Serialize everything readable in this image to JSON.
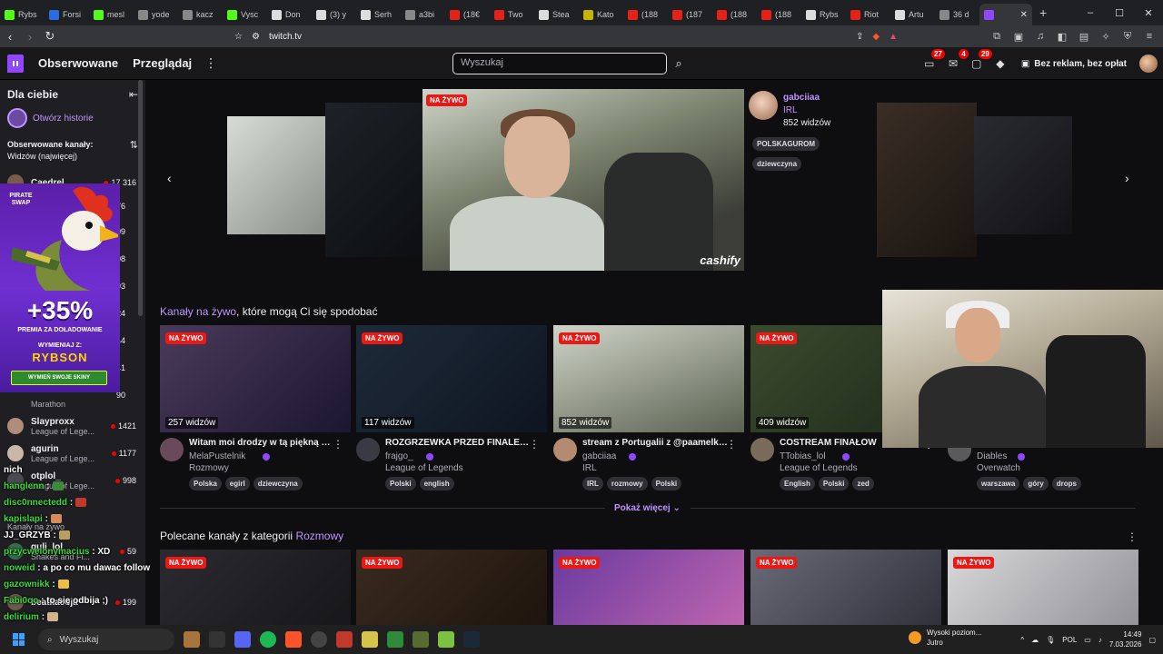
{
  "browser": {
    "tabs": [
      {
        "label": "Rybs",
        "color": "#53fc18"
      },
      {
        "label": "Forsi",
        "color": "#2b6de0"
      },
      {
        "label": "mesl",
        "color": "#53fc18"
      },
      {
        "label": "yode",
        "color": "#888888"
      },
      {
        "label": "kacz",
        "color": "#888888"
      },
      {
        "label": "Vysc",
        "color": "#53fc18"
      },
      {
        "label": "Don",
        "color": "#dddddd"
      },
      {
        "label": "(3) y",
        "color": "#dddddd"
      },
      {
        "label": "Serh",
        "color": "#dddddd"
      },
      {
        "label": "a3bi",
        "color": "#888888"
      },
      {
        "label": "(18€",
        "color": "#e62117"
      },
      {
        "label": "Two",
        "color": "#e62117"
      },
      {
        "label": "Stea",
        "color": "#dddddd"
      },
      {
        "label": "Kato",
        "color": "#c8b400"
      },
      {
        "label": "(188",
        "color": "#e62117"
      },
      {
        "label": "(187",
        "color": "#e62117"
      },
      {
        "label": "(188",
        "color": "#e62117"
      },
      {
        "label": "(188",
        "color": "#e62117"
      },
      {
        "label": "Rybs",
        "color": "#dddddd"
      },
      {
        "label": "Riot",
        "color": "#e62117"
      },
      {
        "label": "Artu",
        "color": "#dddddd"
      },
      {
        "label": "36 d",
        "color": "#888888"
      },
      {
        "label": "",
        "color": "#9147ff",
        "active": true
      }
    ],
    "url": "twitch.tv",
    "window_controls": [
      "–",
      "☐",
      "✕"
    ]
  },
  "topnav": {
    "following": "Obserwowane",
    "browse": "Przeglądaj",
    "search_placeholder": "Wyszukaj",
    "badges": {
      "inbox": "27",
      "whispers": "4",
      "notifications": "29"
    },
    "prime_label": "Bez reklam, bez opłat"
  },
  "sidebar": {
    "title": "Dla ciebie",
    "stories": "Otwórz historie",
    "followed_title": "Obserwowane kanały:",
    "followed_sort": "Widzów (najwięcej)",
    "channels": [
      {
        "name": "Caedrel",
        "game": "",
        "viewers": "17 316"
      },
      {
        "name": "Slayproxx",
        "game": "League of Lege...",
        "viewers": "1421"
      },
      {
        "name": "agurin",
        "game": "League of Lege...",
        "viewers": "1177"
      },
      {
        "name": "otplol_",
        "game": "League of Lege...",
        "viewers": "998"
      },
      {
        "name": "quli_lol",
        "game": "Shakes and Fi...",
        "viewers": "59"
      },
      {
        "name": "beatkacoja",
        "game": "",
        "viewers": "199"
      }
    ],
    "partial_numbers": [
      "76",
      "09",
      "08",
      "93",
      "24",
      "44",
      "41",
      "90"
    ],
    "partial_game": "Marathon",
    "partial_section": "Kanały na żywo"
  },
  "ad": {
    "brand": "PIRATE SWAP",
    "percent": "+35%",
    "subtitle": "PREMIA ZA DOŁADOWANIE",
    "with_label": "WYMIENIAJ Z:",
    "code": "RYBSON",
    "button": "WYMIEŃ SWOJE SKINY"
  },
  "chat_overlay": [
    {
      "user": "nich",
      "msg": "",
      "color": "#ffffff"
    },
    {
      "user": "hanglenn",
      "msg": ":",
      "color": "#3cd93c"
    },
    {
      "user": "disc0nnectedd",
      "msg": ":",
      "color": "#3cd93c"
    },
    {
      "user": "kapislapi",
      "msg": ":",
      "color": "#3cd93c"
    },
    {
      "user": "JJ_GRZYB",
      "msg": ":",
      "color": "#ffffff"
    },
    {
      "user": "przycwelonymacius",
      "msg": ": XD",
      "color": "#3cd93c"
    },
    {
      "user": "noweid",
      "msg": ": a po co mu dawac follow",
      "color": "#3cd93c"
    },
    {
      "user": "gazownikk",
      "msg": ":",
      "color": "#3cd93c"
    },
    {
      "user": "Fabi0oo",
      "msg": ": to się odbija ;)",
      "color": "#3cd93c"
    },
    {
      "user": "delirium",
      "msg": ":",
      "color": "#3cd93c"
    }
  ],
  "hero": {
    "live": "NA ŻYWO",
    "brand_overlay": "cashify",
    "channel": "gabciiaa",
    "category": "IRL",
    "viewers": "852 widzów",
    "tags": [
      "POLSKAGUROM",
      "dziewczyna"
    ]
  },
  "section1": {
    "prefix_highlight": "Kanały na żywo",
    "suffix": ", które mogą Ci się spodobać",
    "cards": [
      {
        "viewers": "257 widzów",
        "title": "Witam moi drodzy w tą piękną sob...",
        "channel": "MelaPustelnik",
        "category": "Rozmowy",
        "tags": [
          "Polska",
          "egirl",
          "dziewczyna"
        ],
        "bg": "linear-gradient(135deg,#4a3a5a,#1c1630)"
      },
      {
        "viewers": "117 widzów",
        "title": "ROZGRZEWKA PRZED FINALEM 1...",
        "channel": "frajgo_",
        "category": "League of Legends",
        "tags": [
          "Polski",
          "english"
        ],
        "bg": "linear-gradient(135deg,#1e2a3a,#0e1520)"
      },
      {
        "viewers": "852 widzów",
        "title": "stream z Portugalii z @paamelka ...",
        "channel": "gabciiaa",
        "category": "IRL",
        "tags": [
          "IRL",
          "rozmowy",
          "Polski"
        ],
        "bg": "linear-gradient(160deg,#cfd4c9,#5b6150)"
      },
      {
        "viewers": "409 widzów",
        "title": "COSTREAM FINAŁÓW",
        "channel": "TTobias_lol",
        "category": "League of Legends",
        "tags": [
          "English",
          "Polski",
          "zed"
        ],
        "bg": "linear-gradient(135deg,#3b4a2e,#1e2a1a)"
      },
      {
        "viewers": "",
        "title": "",
        "channel": "Diables",
        "category": "Overwatch",
        "tags": [
          "warszawa",
          "góry",
          "drops"
        ],
        "bg": "#0e0e10"
      }
    ],
    "show_more": "Pokaż więcej"
  },
  "section2": {
    "prefix": "Polecane",
    "mid": " kanały z kategorii ",
    "category": "Rozmowy",
    "cards": [
      {
        "bg": "linear-gradient(135deg,#2a2a30,#151518)"
      },
      {
        "bg": "linear-gradient(135deg,#3a2a1e,#1a120c)"
      },
      {
        "bg": "linear-gradient(135deg,#6a3aa0,#c86ab0)"
      },
      {
        "bg": "linear-gradient(135deg,#6a6a78,#2a2a34)"
      },
      {
        "bg": "linear-gradient(135deg,#d8d8da,#8a8a90)"
      }
    ]
  },
  "live_label": "NA ŻYWO",
  "taskbar": {
    "search": "Wyszukaj",
    "weather_title": "Wysoki poziom...",
    "weather_sub": "Jutro",
    "lang": "POL",
    "time": "14:49",
    "date": "7.03.2026"
  }
}
